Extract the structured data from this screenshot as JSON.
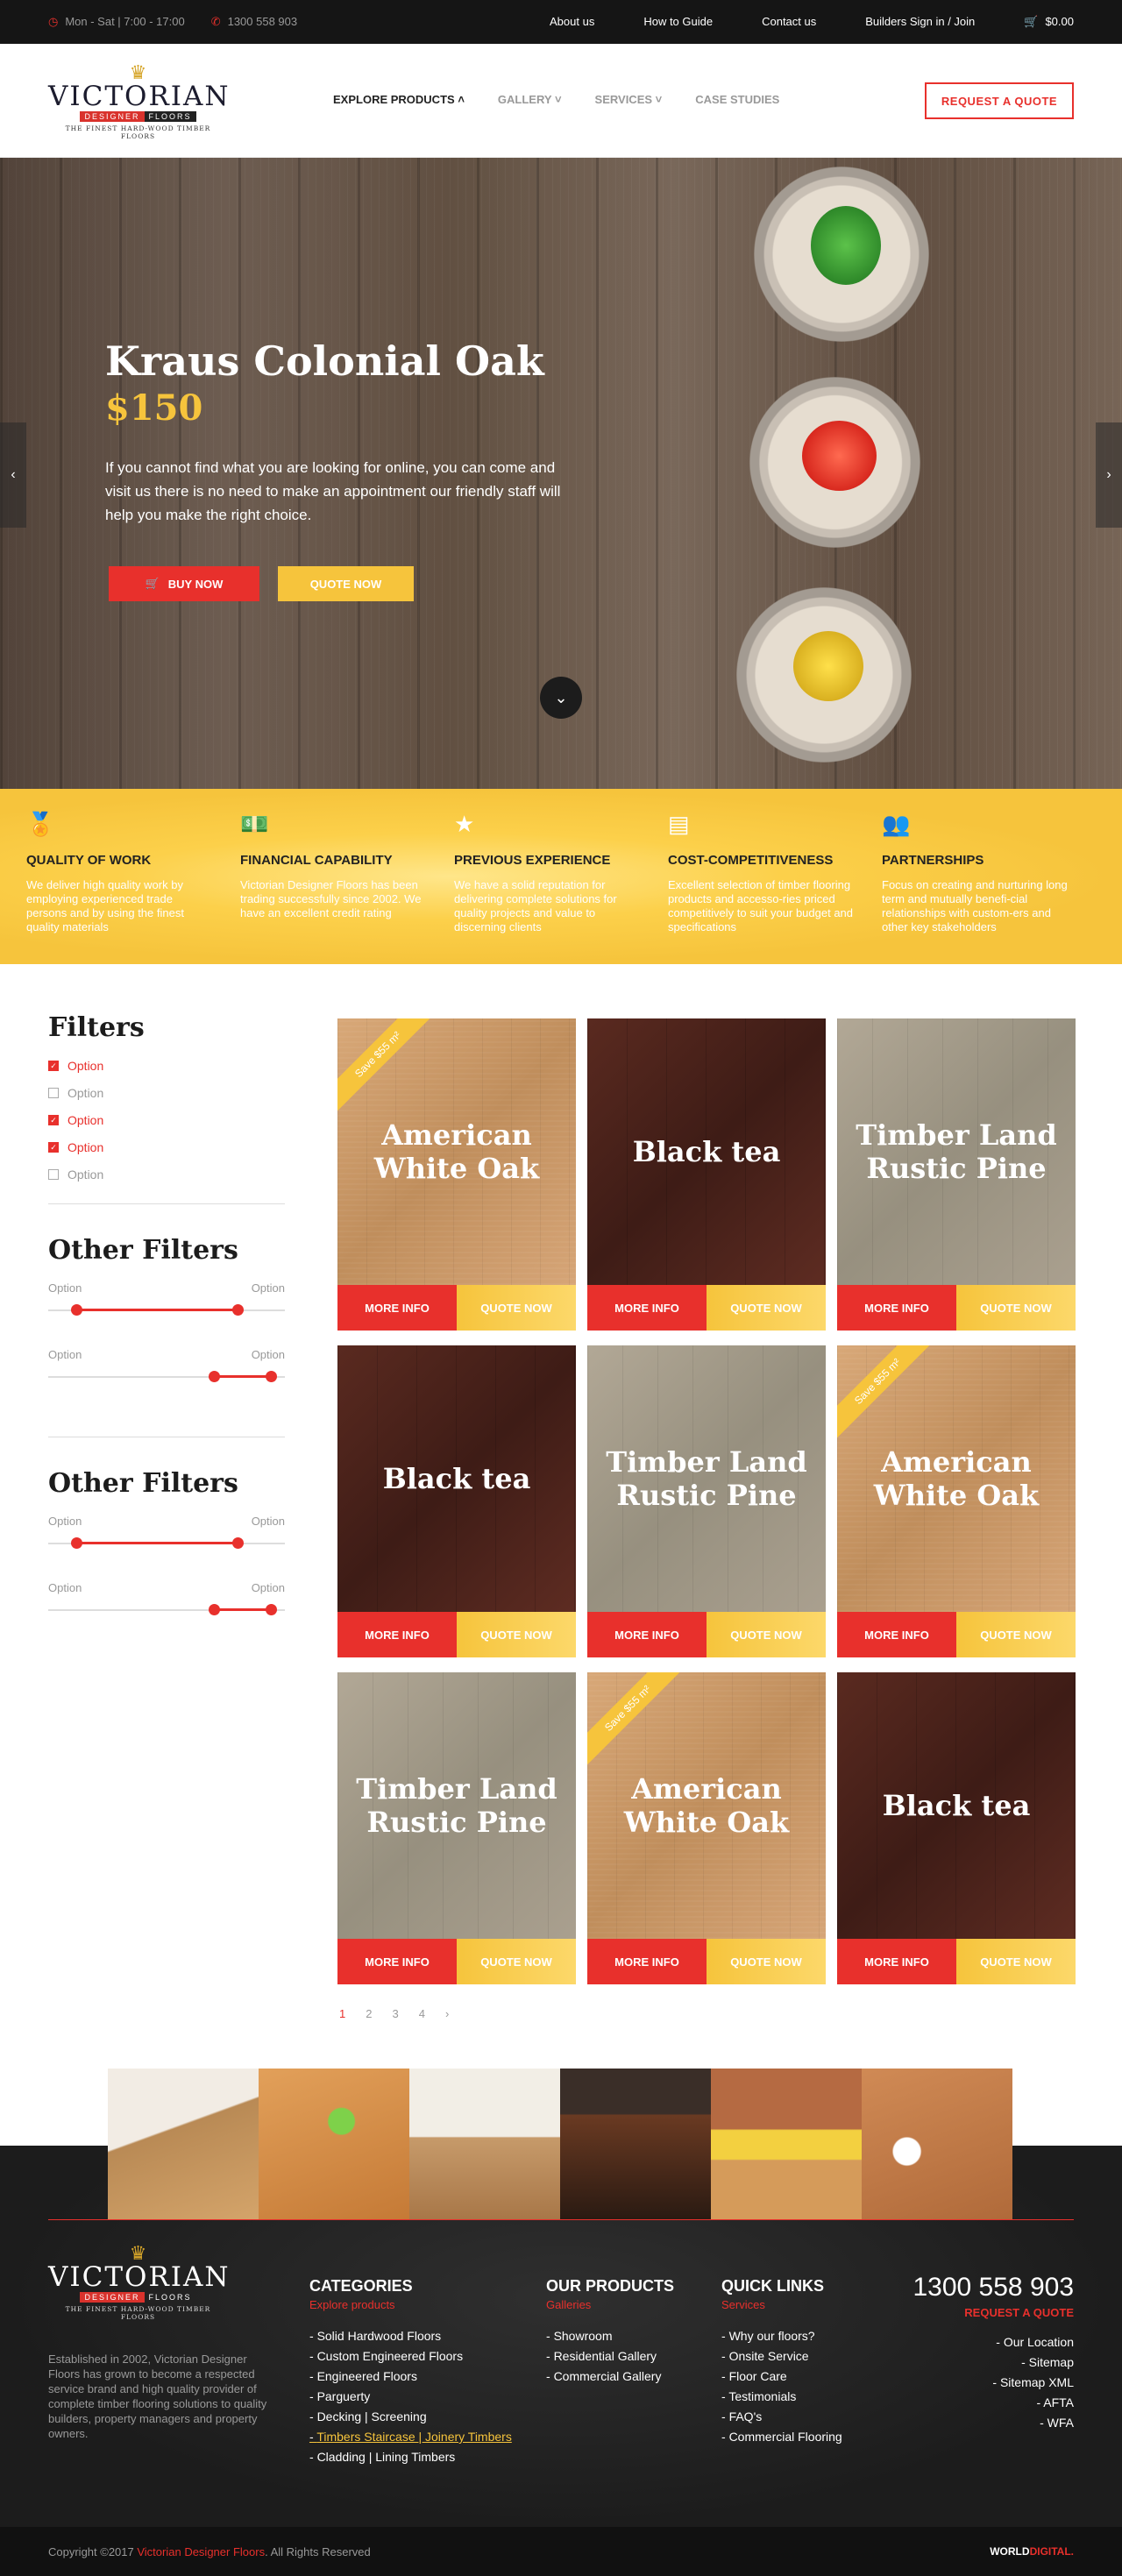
{
  "topbar": {
    "hours": "Mon - Sat | 7:00 - 17:00",
    "phone": "1300 558 903",
    "links": [
      "About us",
      "How to Guide",
      "Contact us",
      "Builders Sign in / Join"
    ],
    "cart_total": "$0.00"
  },
  "logo": {
    "word": "VICTORIAN",
    "sub_a": "DESIGNER",
    "sub_b": "FLOORS",
    "tagline": "THE FINEST HARD-WOOD TIMBER FLOORS"
  },
  "nav": {
    "items": [
      "EXPLORE PRODUCTS",
      "GALLERY",
      "SERVICES",
      "CASE STUDIES"
    ],
    "quote_button": "REQUEST A QUOTE"
  },
  "hero": {
    "title": "Kraus Colonial Oak",
    "price": "$150",
    "text": "If you cannot find what you are looking for online, you can come and visit us there is no need to make an appointment our friendly staff will help you make the right choice.",
    "buy_label": "BUY NOW",
    "quote_label": "QUOTE NOW"
  },
  "features": [
    {
      "title": "QUALITY OF WORK",
      "text": "We deliver high quality work by employing experienced trade persons and by using the finest quality materials",
      "icon": "award-icon"
    },
    {
      "title": "FINANCIAL CAPABILITY",
      "text": "Victorian Designer Floors has been trading successfully since 2002. We have an excellent credit rating",
      "icon": "money-icon"
    },
    {
      "title": "PREVIOUS EXPERIENCE",
      "text": "We have a solid reputation for delivering complete solutions for quality projects and value to discerning clients",
      "icon": "star-badge-icon"
    },
    {
      "title": "COST-COMPETITIVENESS",
      "text": "Excellent selection of timber flooring products and accesso-ries priced competitively to suit your budget and specifications",
      "icon": "wallet-icon"
    },
    {
      "title": "PARTNERSHIPS",
      "text": "Focus on creating and nurturing long term and mutually benefi-cial relationships with custom-ers and other key stakeholders",
      "icon": "people-icon"
    }
  ],
  "filters": {
    "title": "Filters",
    "options": [
      {
        "label": "Option",
        "checked": true
      },
      {
        "label": "Option",
        "checked": false
      },
      {
        "label": "Option",
        "checked": true
      },
      {
        "label": "Option",
        "checked": true
      },
      {
        "label": "Option",
        "checked": false
      }
    ],
    "other_title": "Other Filters",
    "range_label": "Option",
    "ranges": [
      {
        "min": 0.12,
        "max": 0.8
      },
      {
        "min": 0.7,
        "max": 0.94
      },
      {
        "min": 0.12,
        "max": 0.8
      },
      {
        "min": 0.7,
        "max": 0.94
      }
    ]
  },
  "products": [
    {
      "name": "American White Oak",
      "wood": "light",
      "ribbon": "Save $55 m²"
    },
    {
      "name": "Black tea",
      "wood": "dark",
      "ribbon": ""
    },
    {
      "name": "Timber Land Rustic Pine",
      "wood": "grey",
      "ribbon": ""
    },
    {
      "name": "Black tea",
      "wood": "dark",
      "ribbon": ""
    },
    {
      "name": "Timber Land Rustic Pine",
      "wood": "grey",
      "ribbon": ""
    },
    {
      "name": "American White Oak",
      "wood": "light",
      "ribbon": "Save $55 m²"
    },
    {
      "name": "Timber Land Rustic Pine",
      "wood": "grey",
      "ribbon": ""
    },
    {
      "name": "American White Oak",
      "wood": "light",
      "ribbon": "Save $55 m²"
    },
    {
      "name": "Black tea",
      "wood": "dark",
      "ribbon": ""
    }
  ],
  "product_buttons": {
    "more": "MORE INFO",
    "quote": "QUOTE NOW"
  },
  "pagination": [
    "1",
    "2",
    "3",
    "4",
    "›"
  ],
  "footer": {
    "about": "Established in 2002, Victorian Designer Floors has grown to become a respected service brand and high quality provider of complete timber flooring solutions to quality builders, property managers and property owners.",
    "categories": {
      "title": "CATEGORIES",
      "sub": "Explore products",
      "items": [
        "Solid Hardwood Floors",
        "Custom Engineered Floors",
        "Engineered Floors",
        "Parguerty",
        "Decking | Screening",
        "Timbers Staircase | Joinery Timbers",
        "Cladding | Lining Timbers"
      ]
    },
    "products": {
      "title": "OUR PRODUCTS",
      "sub": "Galleries",
      "items": [
        "Showroom",
        "Residential Gallery",
        "Commercial Gallery"
      ]
    },
    "quick": {
      "title": "QUICK LINKS",
      "sub": "Services",
      "items": [
        "Why our floors?",
        "Onsite Service",
        "Floor Care",
        "Testimonials",
        "FAQ's",
        "Commercial Flooring"
      ]
    },
    "phone": "1300 558 903",
    "phone_sub": "REQUEST A QUOTE",
    "right_links": [
      "Our Location",
      "Sitemap",
      "Sitemap XML",
      "AFTA",
      "WFA"
    ]
  },
  "bottom": {
    "copy_pre": "Copyright ©2017 ",
    "copy_brand": "Victorian Designer Floors",
    "copy_post": ". All Rights Reserved",
    "brand_a": "WORLD",
    "brand_b": "DIGITAL."
  },
  "colors": {
    "accent_red": "#e8302c",
    "accent_yellow": "#f6c43c",
    "dark": "#151515"
  }
}
